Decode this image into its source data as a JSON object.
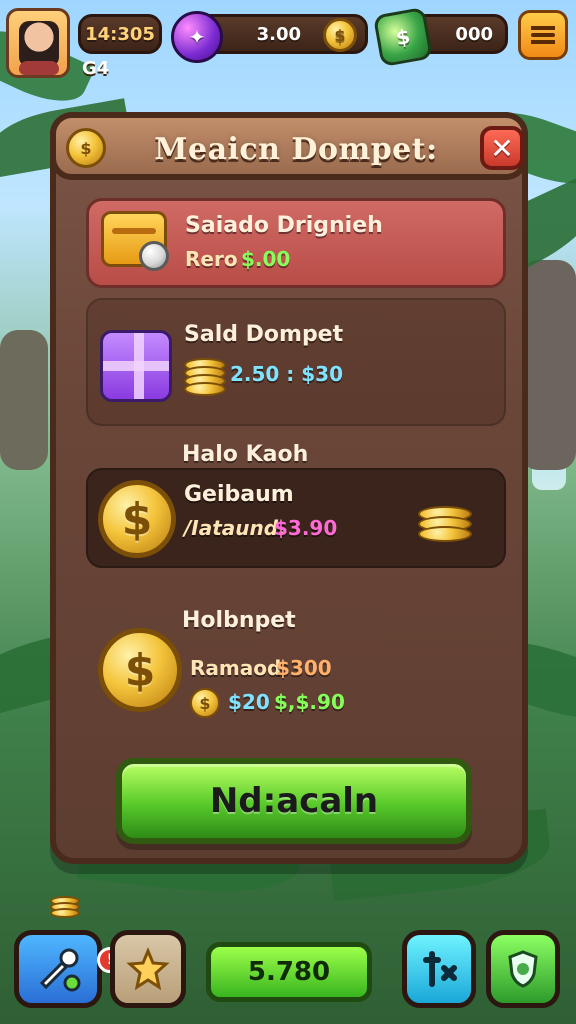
{
  "hud": {
    "avatar_level": "G4",
    "score": "14:305",
    "gems": "3.00",
    "cash": "000"
  },
  "panel": {
    "title": "Meaicn Dompet:",
    "rows": [
      {
        "title": "Saiado Drignieh",
        "line1_prefix": "Rero",
        "line1_value": "$.00"
      },
      {
        "title": "Sald Dompet",
        "line1_value": "2.50 : $30"
      },
      {
        "title": "Halo Kaoh",
        "subtitle": "Geibaum",
        "line1_prefix": "/Iataund.",
        "line1_value": "$3.90"
      },
      {
        "title": "Holbnpet",
        "line1_prefix": "Ramaod",
        "line1_value": "$300",
        "line2_a": "$20",
        "line2_b": "$,$.90"
      }
    ],
    "cta_label": "Nd:acaln"
  },
  "bottom_bar": {
    "center_value": "5.780",
    "notification_badge": "!"
  },
  "icons": {
    "close": "close-icon",
    "menu": "menu-icon",
    "gem": "gem-icon",
    "cash": "cash-icon",
    "coin": "coin-icon"
  }
}
